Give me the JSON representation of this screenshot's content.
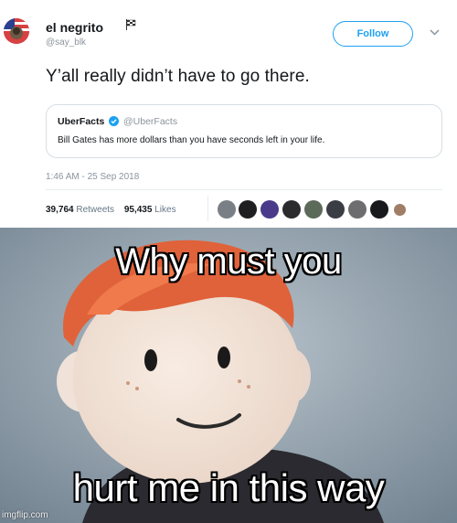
{
  "tweet": {
    "display_name": "el negrito",
    "handle": "@say_blk",
    "follow_label": "Follow",
    "text": "Y’all really didn’t have to go there.",
    "quoted": {
      "name": "UberFacts",
      "handle": "@UberFacts",
      "text": "Bill Gates has more dollars than you have seconds left in your life."
    },
    "timestamp": "1:46 AM - 25 Sep 2018",
    "retweets_count": "39,764",
    "retweets_label": "Retweets",
    "likes_count": "95,435",
    "likes_label": "Likes"
  },
  "meme": {
    "caption_top": "Why must you",
    "caption_bottom": "hurt me in this way"
  },
  "watermark": "imgflip.com",
  "colors": {
    "accent": "#1da1f2",
    "text": "#14171a",
    "muted": "#8a949c"
  }
}
